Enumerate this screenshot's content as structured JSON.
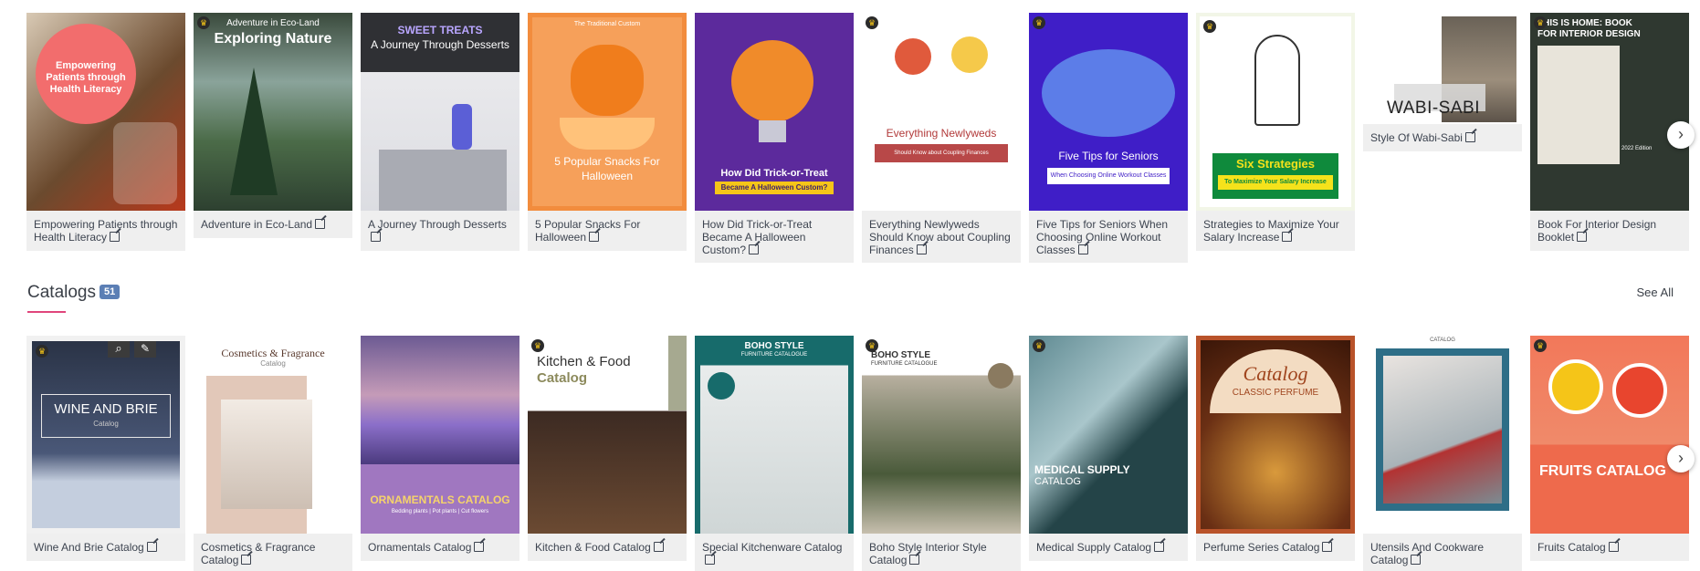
{
  "top_row": {
    "cards": [
      {
        "caption": "Empowering Patients through Health Literacy",
        "thumb_text": "Empowering Patients through Health Literacy",
        "premium": false
      },
      {
        "caption": "Adventure in Eco-Land",
        "thumb_kicker": "Adventure in Eco-Land",
        "thumb_text": "Exploring Nature",
        "premium": true
      },
      {
        "caption": "A Journey Through Desserts",
        "thumb_kicker": "SWEET TREATS",
        "thumb_text": "A Journey Through Desserts",
        "premium": false
      },
      {
        "caption": "5 Popular Snacks For Halloween",
        "thumb_kicker": "The Traditional Custom",
        "thumb_text": "5 Popular Snacks For Halloween",
        "premium": false
      },
      {
        "caption": "How Did Trick-or-Treat Became A Halloween Custom?",
        "thumb_text": "How Did Trick-or-Treat",
        "thumb_sub": "Became A Halloween Custom?",
        "premium": false
      },
      {
        "caption": "Everything Newlyweds Should Know about Coupling Finances",
        "thumb_text": "Everything Newlyweds",
        "thumb_sub": "Should Know about Coupling Finances",
        "premium": true
      },
      {
        "caption": "Five Tips for Seniors When Choosing Online Workout Classes",
        "thumb_text": "Five Tips for Seniors",
        "thumb_sub": "When Choosing Online Workout Classes",
        "premium": true
      },
      {
        "caption": "Strategies to Maximize Your Salary Increase",
        "thumb_text": "Six Strategies",
        "thumb_sub": "To Maximize Your Salary Increase",
        "premium": true
      },
      {
        "caption": "Style Of Wabi-Sabi",
        "thumb_text": "WABI-SABI",
        "premium": false
      },
      {
        "caption": "Book For Interior Design Booklet",
        "thumb_text": "THIS IS HOME: BOOK FOR INTERIOR DESIGN",
        "thumb_sub": "2022 Edition",
        "premium": true
      }
    ]
  },
  "catalogs": {
    "title": "Catalogs",
    "count": "51",
    "see_all": "See All",
    "cards": [
      {
        "caption": "Wine And Brie Catalog",
        "thumb_text": "WINE AND BRIE",
        "thumb_sub": "Catalog",
        "premium": true
      },
      {
        "caption": "Cosmetics & Fragrance Catalog",
        "thumb_text": "Cosmetics & Fragrance",
        "thumb_sub": "Catalog",
        "premium": false
      },
      {
        "caption": "Ornamentals Catalog",
        "thumb_text": "ORNAMENTALS CATALOG",
        "thumb_sub": "Bedding plants | Pot plants | Cut flowers",
        "premium": false
      },
      {
        "caption": "Kitchen & Food Catalog",
        "thumb_text": "Kitchen & Food",
        "thumb_sub": "Catalog",
        "premium": true
      },
      {
        "caption": "Special Kitchenware Catalog",
        "thumb_text": "BOHO STYLE",
        "thumb_sub": "FURNITURE CATALOGUE",
        "premium": false
      },
      {
        "caption": "Boho Style Interior Style Catalog",
        "thumb_text": "BOHO STYLE",
        "thumb_sub": "FURNITURE CATALOGUE",
        "premium": true
      },
      {
        "caption": "Medical Supply Catalog",
        "thumb_text": "MEDICAL SUPPLY",
        "thumb_sub": "CATALOG",
        "premium": true
      },
      {
        "caption": "Perfume Series Catalog",
        "thumb_text": "Catalog",
        "thumb_sub": "CLASSIC PERFUME",
        "premium": false
      },
      {
        "caption": "Utensils And Cookware Catalog",
        "thumb_text": "CATALOG",
        "premium": false
      },
      {
        "caption": "Fruits Catalog",
        "thumb_text": "FRUITS CATALOG",
        "premium": true
      }
    ]
  },
  "icons": {
    "crown": "♛",
    "next_arrow": "›",
    "search": "⌕",
    "edit": "✎"
  }
}
